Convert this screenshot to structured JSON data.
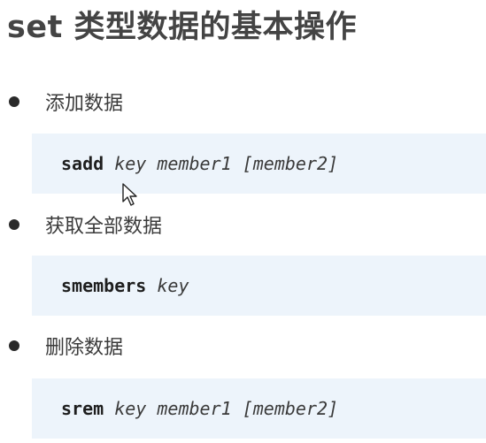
{
  "title": "set 类型数据的基本操作",
  "sections": [
    {
      "label": "添加数据",
      "command": "sadd",
      "args": " key member1 [member2]"
    },
    {
      "label": "获取全部数据",
      "command": "smembers",
      "args": " key"
    },
    {
      "label": "删除数据",
      "command": "srem",
      "args": " key member1 [member2]"
    }
  ]
}
